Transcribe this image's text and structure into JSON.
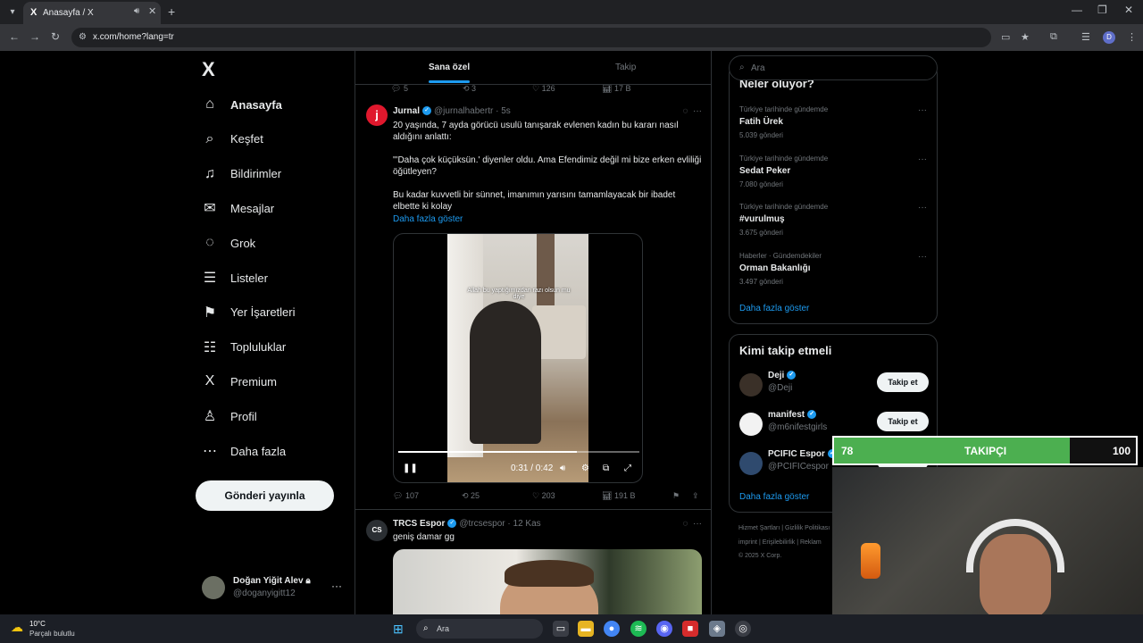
{
  "browser": {
    "tab_title": "Anasayfa / X",
    "tab_favicon": "X",
    "url": "x.com/home?lang=tr",
    "profile_initial": "D"
  },
  "sidebar": {
    "logo": "X",
    "items": [
      {
        "label": "Anasayfa",
        "icon": "home-icon",
        "glyph": "⌂"
      },
      {
        "label": "Keşfet",
        "icon": "search-icon",
        "glyph": "⌕"
      },
      {
        "label": "Bildirimler",
        "icon": "bell-icon",
        "glyph": "♫"
      },
      {
        "label": "Mesajlar",
        "icon": "envelope-icon",
        "glyph": "✉"
      },
      {
        "label": "Grok",
        "icon": "grok-icon",
        "glyph": "◌"
      },
      {
        "label": "Listeler",
        "icon": "list-icon",
        "glyph": "☰"
      },
      {
        "label": "Yer İşaretleri",
        "icon": "bookmark-icon",
        "glyph": "⚑"
      },
      {
        "label": "Topluluklar",
        "icon": "communities-icon",
        "glyph": "☷"
      },
      {
        "label": "Premium",
        "icon": "x-icon",
        "glyph": "X"
      },
      {
        "label": "Profil",
        "icon": "profile-icon",
        "glyph": "♙"
      },
      {
        "label": "Daha fazla",
        "icon": "more-circle-icon",
        "glyph": "⋯"
      }
    ],
    "post_button": "Gönderi yayınla",
    "account": {
      "name": "Doğan Yiğit Alev",
      "handle": "@doganyigitt12"
    }
  },
  "timeline": {
    "tabs": [
      "Sana özel",
      "Takip"
    ],
    "prev_actions": {
      "replies": "5",
      "reposts": "3",
      "likes": "126",
      "views": "17 B"
    },
    "tweets": [
      {
        "name": "Jurnal",
        "handle": "@jurnalhabertr",
        "time": "5s",
        "avatar_color": "#e0182d",
        "avatar_letter": "j",
        "text": "20 yaşında, 7 ayda görücü usulü tanışarak evlenen kadın bu kararı nasıl aldığını anlattı:\n\n\"'Daha çok küçüksün.' diyenler oldu. Ama Efendimiz değil mi bize erken evliliği öğütleyen?\n\nBu kadar kuvvetli bir sünnet, imanımın yarısını tamamlayacak bir ibadet elbette ki kolay",
        "show_more": "Daha fazla göster",
        "video": {
          "caption": "Allah bu yaptığımızdan razı olsun mu diye",
          "time": "0:31 / 0:42",
          "progress": 0.74
        },
        "actions": {
          "replies": "107",
          "reposts": "25",
          "likes": "203",
          "views": "191 B"
        }
      },
      {
        "name": "TRCS Espor",
        "handle": "@trcsespor",
        "time": "12 Kas",
        "avatar_color": "#2b2f33",
        "avatar_letter": "CS",
        "text": "geniş damar gg"
      }
    ]
  },
  "right": {
    "search_placeholder": "Ara",
    "trends_title": "Neler oluyor?",
    "trends": [
      {
        "context": "Türkiye tarihinde gündemde",
        "name": "Fatih Ürek",
        "count": "5.039 gönderi"
      },
      {
        "context": "Türkiye tarihinde gündemde",
        "name": "Sedat Peker",
        "count": "7.080 gönderi"
      },
      {
        "context": "Türkiye tarihinde gündemde",
        "name": "#vurulmuş",
        "count": "3.675 gönderi"
      },
      {
        "context": "Haberler · Gündemdekiler",
        "name": "Orman Bakanlığı",
        "count": "3.497 gönderi"
      }
    ],
    "trends_more": "Daha fazla göster",
    "who_title": "Kimi takip etmeli",
    "who": [
      {
        "name": "Deji",
        "handle": "@Deji",
        "avatar_color": "#3a3028"
      },
      {
        "name": "manifest",
        "handle": "@m6nifestgirls",
        "avatar_color": "#f2f2f2"
      },
      {
        "name": "PCIFIC Espor",
        "handle": "@PCIFICespor",
        "avatar_color": "#2f4a6e"
      }
    ],
    "follow_label": "Takip et",
    "who_more": "Daha fazla göster",
    "footer_line1": "Hizmet Şartları  |  Gizlilik Politikası",
    "footer_line2": "imprint  |  Erişilebilirlik  |  Reklam",
    "footer_line3": "© 2025 X Corp."
  },
  "overlay": {
    "current": "78",
    "label": "TAKIPÇI",
    "goal": "100",
    "progress": 0.78
  },
  "taskbar": {
    "temp": "10°C",
    "weather": "Parçalı bulutlu",
    "search": "Ara"
  }
}
